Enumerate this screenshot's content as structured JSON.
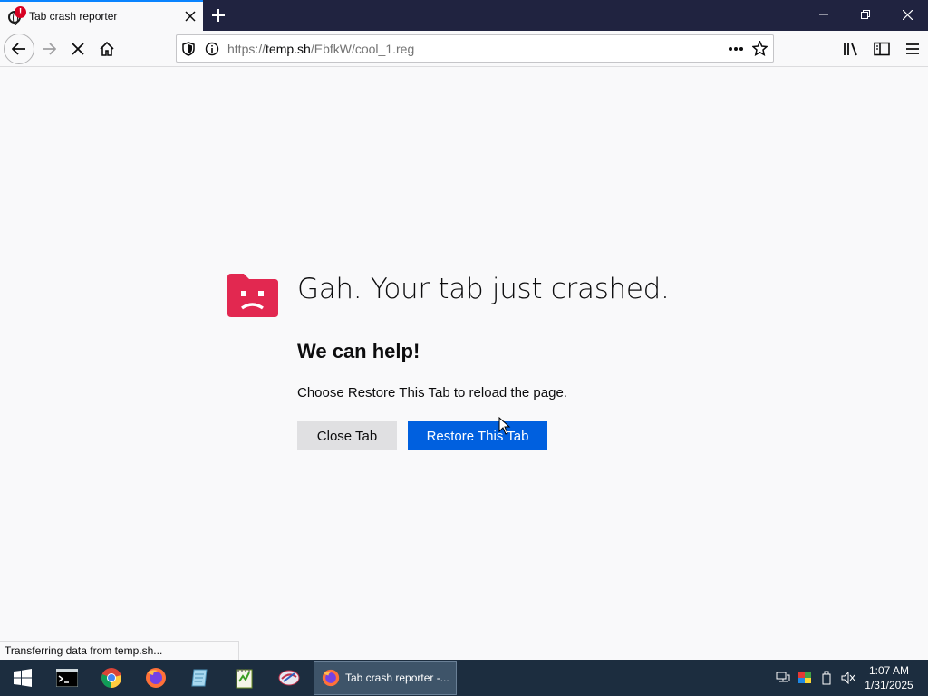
{
  "tab": {
    "title": "Tab crash reporter",
    "badge": "!"
  },
  "url": {
    "prefix": "https://",
    "host": "temp.sh",
    "path": "/EbfkW/cool_1.reg"
  },
  "content": {
    "title": "Gah. Your tab just crashed.",
    "subtitle": "We can help!",
    "description": "Choose Restore This Tab to reload the page.",
    "close_button": "Close Tab",
    "restore_button": "Restore This Tab"
  },
  "status": {
    "text": "Transferring data from temp.sh..."
  },
  "taskbar": {
    "active_window": "Tab crash reporter -...",
    "time": "1:07 AM",
    "date": "1/31/2025"
  },
  "colors": {
    "accent": "#0060df",
    "crash_red": "#e22850",
    "tabbar": "#202340",
    "taskbar": "#1c2d3f"
  }
}
